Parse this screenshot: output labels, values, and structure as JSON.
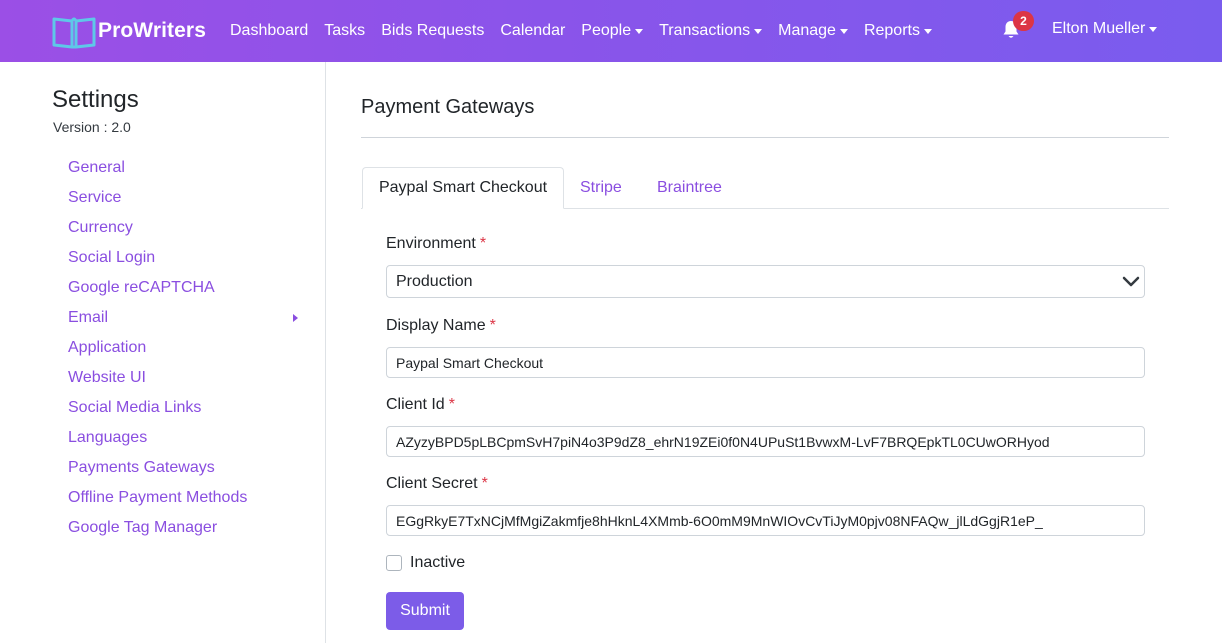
{
  "colors": {
    "navbar_start": "#9b4fe6",
    "navbar_end": "#7a5cee",
    "link": "#8a4ee0",
    "button": "#7c5ce8",
    "required": "#dc3545",
    "badge": "#dc3545"
  },
  "navbar": {
    "brand": "ProWriters",
    "brand_icon": "open-book-icon",
    "items": [
      {
        "label": "Dashboard",
        "dropdown": false
      },
      {
        "label": "Tasks",
        "dropdown": false
      },
      {
        "label": "Bids Requests",
        "dropdown": false
      },
      {
        "label": "Calendar",
        "dropdown": false
      },
      {
        "label": "People",
        "dropdown": true
      },
      {
        "label": "Transactions",
        "dropdown": true
      },
      {
        "label": "Manage",
        "dropdown": true
      },
      {
        "label": "Reports",
        "dropdown": true
      }
    ],
    "notifications": {
      "icon": "bell-icon",
      "count": "2"
    },
    "user": "Elton Mueller"
  },
  "sidebar": {
    "title": "Settings",
    "version": "Version : 2.0",
    "items": [
      {
        "label": "General"
      },
      {
        "label": "Service"
      },
      {
        "label": "Currency"
      },
      {
        "label": "Social Login"
      },
      {
        "label": "Google reCAPTCHA"
      },
      {
        "label": "Email",
        "submenu": true
      },
      {
        "label": "Application"
      },
      {
        "label": "Website UI"
      },
      {
        "label": "Social Media Links"
      },
      {
        "label": "Languages"
      },
      {
        "label": "Payments Gateways"
      },
      {
        "label": "Offline Payment Methods"
      },
      {
        "label": "Google Tag Manager"
      }
    ]
  },
  "main": {
    "title": "Payment Gateways",
    "tabs": [
      {
        "label": "Paypal Smart Checkout",
        "active": true
      },
      {
        "label": "Stripe",
        "active": false
      },
      {
        "label": "Braintree",
        "active": false
      }
    ],
    "form": {
      "environment_label": "Environment",
      "environment_value": "Production",
      "display_name_label": "Display Name",
      "display_name_value": "Paypal Smart Checkout",
      "client_id_label": "Client Id",
      "client_id_value": "AZyzyBPD5pLBCpmSvH7piN4o3P9dZ8_ehrN19ZEi0f0N4UPuSt1BvwxM-LvF7BRQEpkTL0CUwORHyod",
      "client_secret_label": "Client Secret",
      "client_secret_value": "EGgRkyE7TxNCjMfMgiZakmfje8hHknL4XMmb-6O0mM9MnWIOvCvTiJyM0pjv08NFAQw_jlLdGgjR1eP_",
      "required_mark": "*",
      "inactive_label": "Inactive",
      "inactive_checked": false,
      "submit_label": "Submit"
    }
  }
}
